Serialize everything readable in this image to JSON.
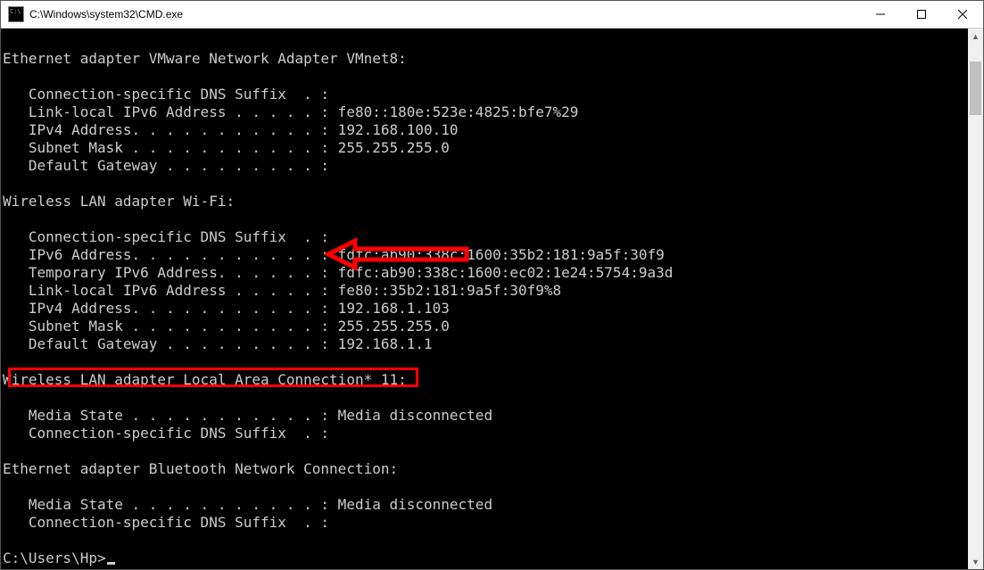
{
  "window": {
    "title": "C:\\Windows\\system32\\CMD.exe"
  },
  "prompt": "C:\\Users\\Hp>",
  "adapters": [
    {
      "header": "Ethernet adapter VMware Network Adapter VMnet8:",
      "rows": [
        {
          "label": "   Connection-specific DNS Suffix  . :",
          "value": ""
        },
        {
          "label": "   Link-local IPv6 Address . . . . . :",
          "value": " fe80::180e:523e:4825:bfe7%29"
        },
        {
          "label": "   IPv4 Address. . . . . . . . . . . :",
          "value": " 192.168.100.10"
        },
        {
          "label": "   Subnet Mask . . . . . . . . . . . :",
          "value": " 255.255.255.0"
        },
        {
          "label": "   Default Gateway . . . . . . . . . :",
          "value": ""
        }
      ]
    },
    {
      "header": "Wireless LAN adapter Wi-Fi:",
      "rows": [
        {
          "label": "   Connection-specific DNS Suffix  . :",
          "value": ""
        },
        {
          "label": "   IPv6 Address. . . . . . . . . . . :",
          "value": " fdfc:ab90:338c:1600:35b2:181:9a5f:30f9"
        },
        {
          "label": "   Temporary IPv6 Address. . . . . . :",
          "value": " fdfc:ab90:338c:1600:ec02:1e24:5754:9a3d"
        },
        {
          "label": "   Link-local IPv6 Address . . . . . :",
          "value": " fe80::35b2:181:9a5f:30f9%8"
        },
        {
          "label": "   IPv4 Address. . . . . . . . . . . :",
          "value": " 192.168.1.103"
        },
        {
          "label": "   Subnet Mask . . . . . . . . . . . :",
          "value": " 255.255.255.0"
        },
        {
          "label": "   Default Gateway . . . . . . . . . :",
          "value": " 192.168.1.1"
        }
      ]
    },
    {
      "header": "Wireless LAN adapter Local Area Connection* 11:",
      "rows": [
        {
          "label": "   Media State . . . . . . . . . . . :",
          "value": " Media disconnected"
        },
        {
          "label": "   Connection-specific DNS Suffix  . :",
          "value": ""
        }
      ]
    },
    {
      "header": "Ethernet adapter Bluetooth Network Connection:",
      "rows": [
        {
          "label": "   Media State . . . . . . . . . . . :",
          "value": " Media disconnected"
        },
        {
          "label": "   Connection-specific DNS Suffix  . :",
          "value": ""
        }
      ]
    }
  ],
  "annotation": {
    "arrow_color": "#ff0000",
    "box_color": "#ff0000"
  }
}
